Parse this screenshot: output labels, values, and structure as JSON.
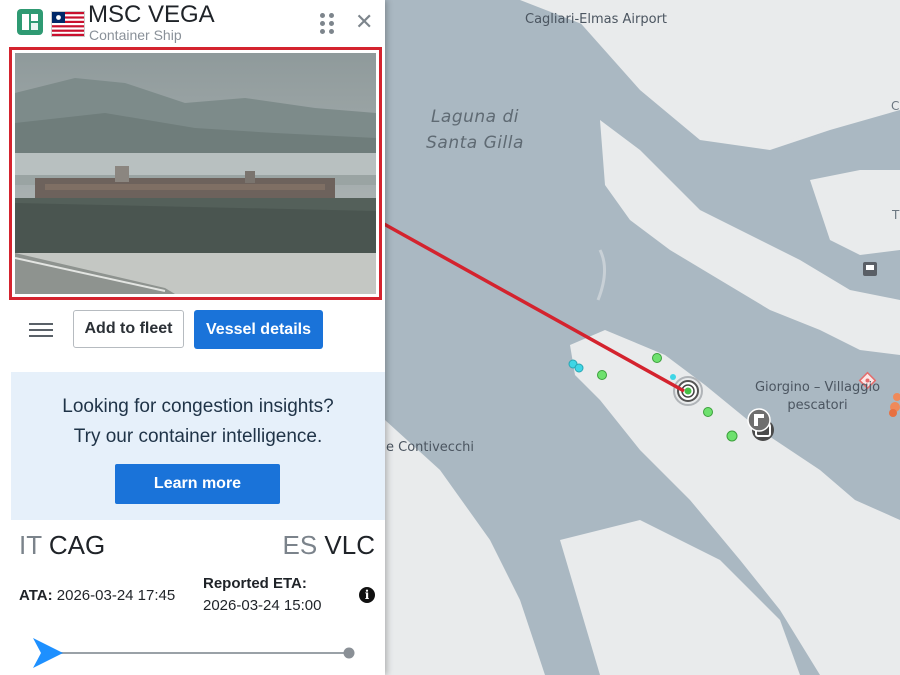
{
  "vessel": {
    "name": "MSC VEGA",
    "type": "Container Ship",
    "flag": "Liberia"
  },
  "header": {
    "logo_icon": "app-logo-icon",
    "drag_icon": "drag-handle-icon",
    "close_icon": "close-icon",
    "close_glyph": "✕"
  },
  "photo": {
    "description_icon": "vessel-photo",
    "highlight_color": "#d4232e"
  },
  "actions": {
    "menu_icon": "hamburger-menu-icon",
    "add_to_fleet": "Add to fleet",
    "vessel_details": "Vessel details"
  },
  "promo": {
    "line1": "Looking for congestion insights?",
    "line2": "Try our container intelligence.",
    "button": "Learn more"
  },
  "voyage": {
    "origin_country": "IT",
    "origin_port": "CAG",
    "destination_country": "ES",
    "destination_port": "VLC",
    "ata_label": "ATA:",
    "ata_value": "2026-03-24 17:45",
    "eta_label": "Reported ETA:",
    "eta_value": "2026-03-24 15:00",
    "info_glyph": "i",
    "progress": 0.0
  },
  "map": {
    "labels": {
      "airport": "Cagliari-Elmas Airport",
      "lagoon_line1": "Laguna di",
      "lagoon_line2": "Santa Gilla",
      "village_line1": "Giorgino – Villaggio",
      "village_line2": "pescatori",
      "contivecchi": "e Contivecchi",
      "edge_c": "C",
      "edge_t": "T"
    },
    "colors": {
      "water": "#aab8c2",
      "land": "#e9ebec",
      "accent": "#1a73d9"
    }
  }
}
